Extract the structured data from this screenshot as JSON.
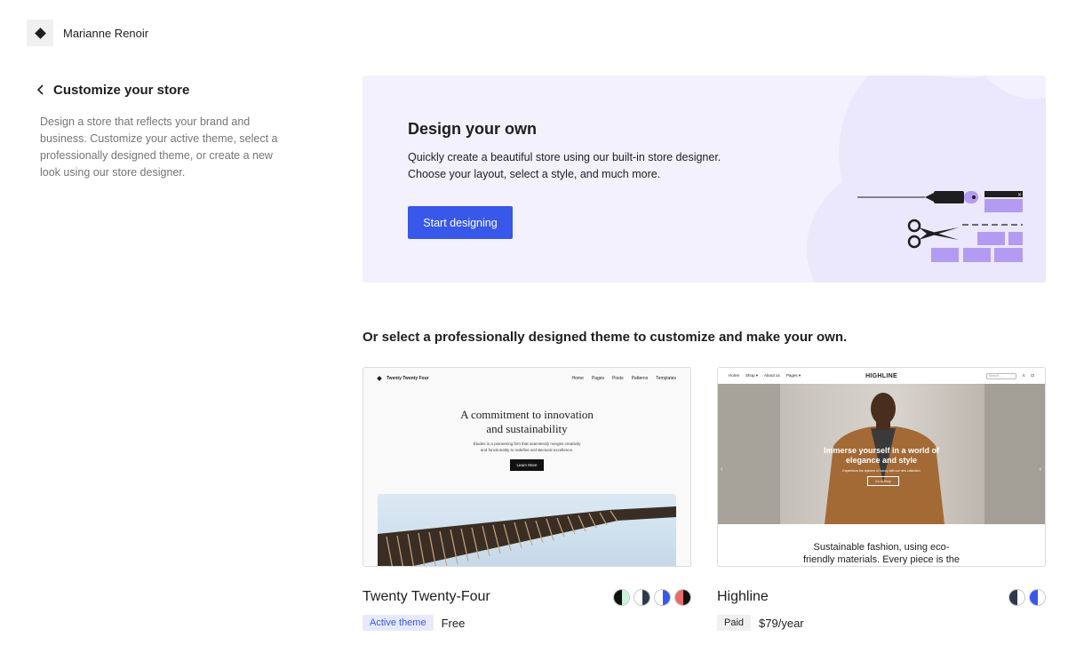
{
  "site": {
    "name": "Marianne Renoir"
  },
  "sidebar": {
    "title": "Customize your store",
    "description": "Design a store that reflects your brand and business. Customize your active theme, select a professionally designed theme, or create a new look using our store designer."
  },
  "hero": {
    "title": "Design your own",
    "description": "Quickly create a beautiful store using our built-in store designer. Choose your layout, select a style, and much more.",
    "button_label": "Start designing"
  },
  "themes_heading": "Or select a professionally designed theme to customize and make your own.",
  "themes": [
    {
      "name": "Twenty Twenty-Four",
      "badge": "Active theme",
      "price": "Free",
      "swatches": [
        [
          "#111111",
          "#c9f2d9"
        ],
        [
          "#ffffff",
          "#2c3a4a"
        ],
        [
          "#ffffff",
          "#3858e9"
        ],
        [
          "#111111",
          "#e86a6a"
        ]
      ],
      "preview": {
        "brand": "Twenty Twenty Four",
        "nav": [
          "Home",
          "Pages",
          "Posts",
          "Patterns",
          "Templates"
        ],
        "headline": "A commitment to innovation and sustainability",
        "sub": "Études is a pioneering firm that seamlessly merges creativity and functionality to redefine architectural excellence.",
        "button": "Learn More"
      }
    },
    {
      "name": "Highline",
      "badge": "Paid",
      "price": "$79/year",
      "swatches": [
        [
          "#ffffff",
          "#2c3a4a"
        ],
        [
          "#ffffff",
          "#3858e9"
        ]
      ],
      "preview": {
        "brand": "HIGHLINE",
        "nav": [
          "Home",
          "Shop ▾",
          "About us",
          "Pages ▾"
        ],
        "search": "Search...",
        "headline": "Immerse yourself in a world of elegance and style",
        "sub": "Experience the epitome of luxury with our new collection",
        "button": "Go to Shop",
        "tagline": "Sustainable fashion, using eco-friendly materials. Every piece is the"
      }
    }
  ]
}
